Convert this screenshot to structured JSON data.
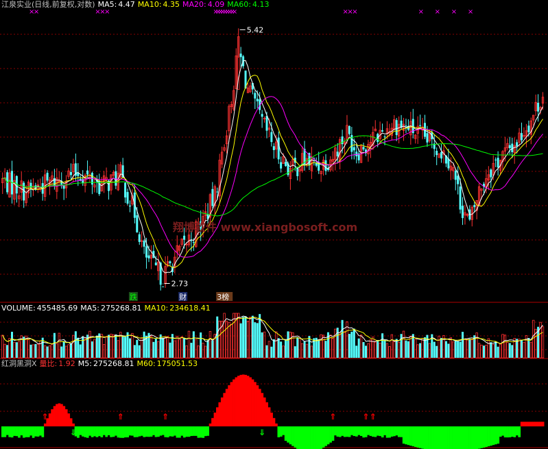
{
  "colors": {
    "up": "#ff3232",
    "down": "#54ffff",
    "ma5": "#ffffff",
    "ma10": "#ffff00",
    "ma20": "#ff00ff",
    "ma60": "#00ff00",
    "grid": "#8b0000",
    "bg": "#000000",
    "white": "#ffffff",
    "gray": "#c0c0c0",
    "sig_red": "#ff0000",
    "sig_green": "#00ff00"
  },
  "chart_data": {
    "type": "candlestick",
    "price": {
      "title": "江泉实业(日线,前复权,对数)",
      "ma5": {
        "label": "MA5:",
        "value": "4.47"
      },
      "ma10": {
        "label": "MA10:",
        "value": "4.35"
      },
      "ma20": {
        "label": "MA20:",
        "value": "4.09"
      },
      "ma60": {
        "label": "MA60:",
        "value": "4.13"
      },
      "high_label": "5.42",
      "low_label": "2.73",
      "ylim": [
        2.6,
        5.7
      ],
      "scale": "log",
      "event_marks": [
        {
          "text": "跌",
          "index": 55,
          "color": "#00ff00",
          "bg": "#1a4d1a"
        },
        {
          "text": "财",
          "index": 76,
          "color": "#ffffff",
          "bg": "#1a2a6a"
        },
        {
          "text": "3榜",
          "index": 92,
          "color": "#ffffff",
          "bg": "#6a3a1a"
        }
      ],
      "top_marks": [
        12,
        14,
        40,
        42,
        44,
        90,
        91,
        92,
        93,
        94,
        95,
        96,
        97,
        98,
        145,
        147,
        149,
        177,
        184,
        191,
        198
      ],
      "watermark": "翔博软件 www.xiangbosoft.com"
    },
    "volume": {
      "label": "VOLUME:",
      "value": "455485.69",
      "ma5": {
        "label": "MA5:",
        "value": "275268.81"
      },
      "ma10": {
        "label": "MA10:",
        "value": "234618.41"
      }
    },
    "indicator": {
      "name": "红洞黑洞X",
      "ratio": {
        "label": "量比:",
        "value": "1.92"
      },
      "m5": {
        "label": "M5:",
        "value": "275268.81"
      },
      "m60": {
        "label": "M60:",
        "value": "175051.53"
      },
      "up_arrows": [
        18,
        50,
        69,
        140,
        154,
        157
      ],
      "down_arrows": [
        30,
        56,
        110,
        145,
        157,
        160
      ],
      "zero_ratio": 0.0
    }
  }
}
